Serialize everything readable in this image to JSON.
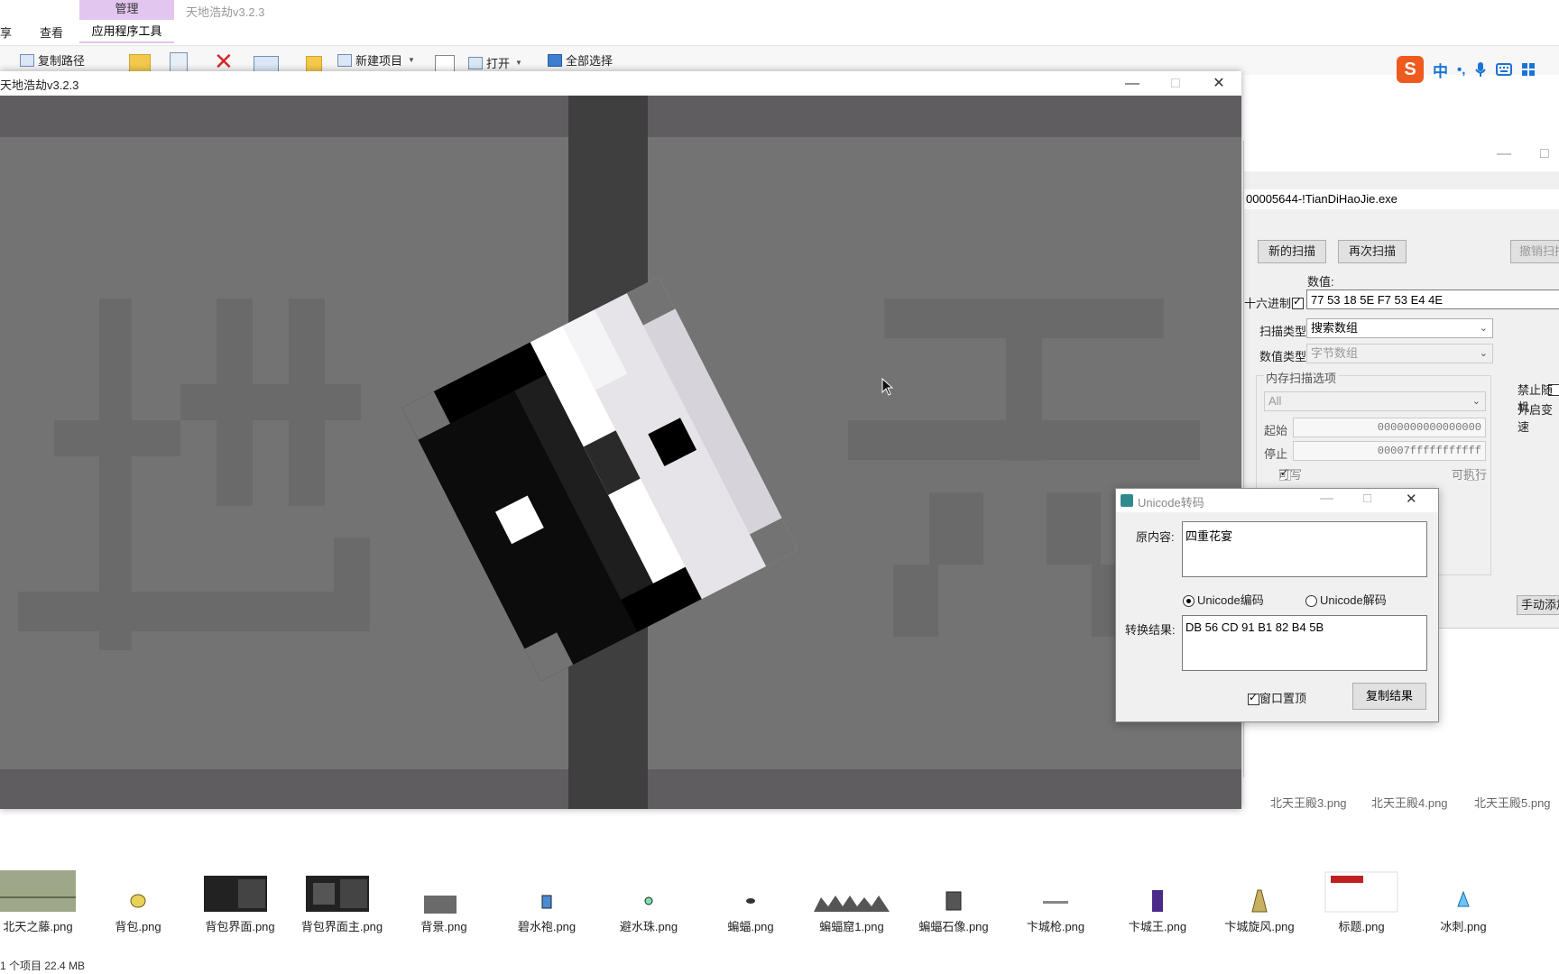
{
  "explorer": {
    "tab_share": "享",
    "tab_view": "查看",
    "tab_manage": "管理",
    "tab_app_tools": "应用程序工具",
    "title": "天地浩劫v3.2.3",
    "ribbon": {
      "copy_path": "复制路径",
      "new_item": "新建项目",
      "open": "打开",
      "select_all": "全部选择"
    },
    "files": [
      {
        "name": "北天之藤.png",
        "icon": "vine-tile-thumb"
      },
      {
        "name": "背包.png",
        "icon": "bag-thumb"
      },
      {
        "name": "背包界面.png",
        "icon": "bag-ui-thumb"
      },
      {
        "name": "背包界面主.png",
        "icon": "bag-ui-main-thumb"
      },
      {
        "name": "背景.png",
        "icon": "background-thumb"
      },
      {
        "name": "碧水袍.png",
        "icon": "robe-thumb"
      },
      {
        "name": "避水珠.png",
        "icon": "pearl-thumb"
      },
      {
        "name": "蝙蝠.png",
        "icon": "bat-thumb"
      },
      {
        "name": "蝙蝠窟1.png",
        "icon": "bat-cave-thumb"
      },
      {
        "name": "蝙蝠石像.png",
        "icon": "bat-statue-thumb"
      },
      {
        "name": "卞城枪.png",
        "icon": "spear-thumb"
      },
      {
        "name": "卞城王.png",
        "icon": "king-thumb"
      },
      {
        "name": "卞城旋风.png",
        "icon": "whirlwind-thumb"
      },
      {
        "name": "标题.png",
        "icon": "title-thumb"
      },
      {
        "name": "冰刺.png",
        "icon": "ice-thorn-thumb"
      }
    ],
    "cut_files": [
      "北天王殿3.png",
      "北天王殿4.png",
      "北天王殿5.png"
    ],
    "status": "1 个项目  22.4 MB"
  },
  "ime": {
    "logo": "S",
    "mode": "中",
    "punct": "•,",
    "voice_icon": "microphone-icon",
    "keyboard_icon": "keyboard-icon",
    "grid_icon": "grid-icon"
  },
  "game_window": {
    "title": "天地浩劫v3.2.3",
    "minimize": "—",
    "maximize": "□",
    "close": "✕",
    "scene_chars": [
      "地",
      "天"
    ]
  },
  "cheat_engine": {
    "process": "00005644-!TianDiHaoJie.exe",
    "new_scan": "新的扫描",
    "next_scan": "再次扫描",
    "undo_scan": "撤销扫描",
    "value_label": "数值:",
    "hex_label": "十六进制",
    "hex_checked": true,
    "value": "77 53 18 5E F7 53 E4 4E",
    "scan_type_label": "扫描类型",
    "scan_type": "搜索数组",
    "value_type_label": "数值类型",
    "value_type": "字节数组",
    "mem_options_label": "内存扫描选项",
    "mem_region": "All",
    "start_label": "起始",
    "start_value": "0000000000000000",
    "stop_label": "停止",
    "stop_value": "00007fffffffffff",
    "writable_label": "可写",
    "executable_label": "可执行",
    "no_random_label": "禁止随机",
    "speedhack_label": "开启变速",
    "manual_add": "手动添加"
  },
  "unicode_dialog": {
    "title": "Unicode转码",
    "source_label": "原内容:",
    "source_text": "四重花宴",
    "encode_label": "Unicode编码",
    "decode_label": "Unicode解码",
    "mode": "encode",
    "result_label": "转换结果:",
    "result_text": "DB 56 CD 91 B1 82 B4 5B",
    "topmost_label": "窗口置顶",
    "topmost_checked": true,
    "copy_button": "复制结果"
  }
}
